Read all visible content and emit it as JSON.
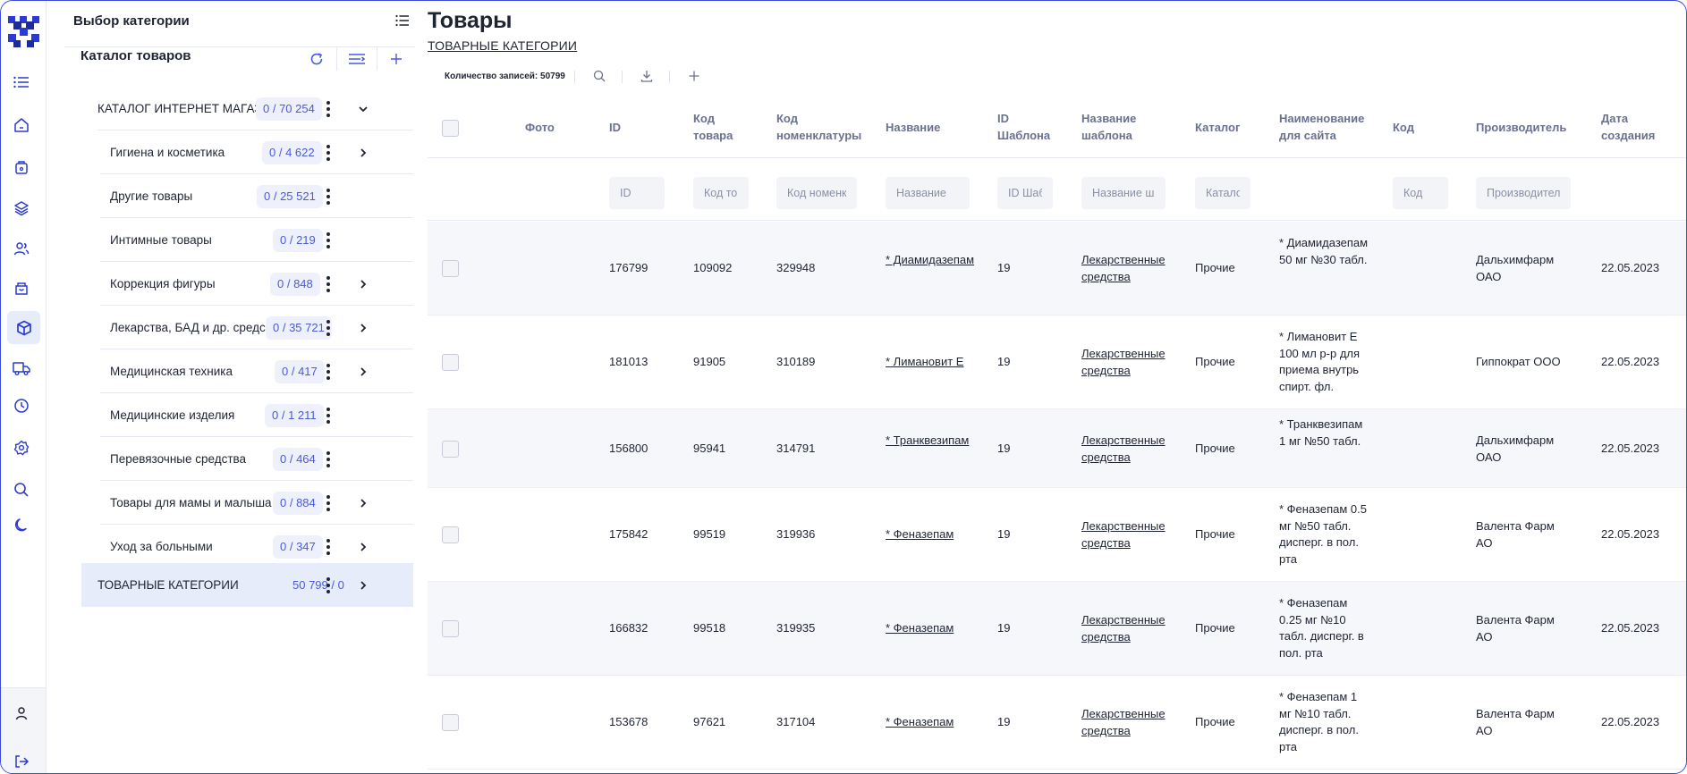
{
  "rail": {
    "items": [
      "list-icon",
      "home-icon",
      "bag-icon",
      "layers-icon",
      "users-icon",
      "box-icon",
      "cube-icon",
      "truck-icon",
      "clock-icon",
      "gear-icon",
      "search-icon",
      "moon-icon"
    ],
    "active": "cube-icon",
    "bottom": [
      "user-icon",
      "logout-icon"
    ]
  },
  "category_panel": {
    "header": "Выбор категории",
    "catalog_title": "Каталог товаров",
    "tree": [
      {
        "label": "КАТАЛОГ ИНТЕРНЕТ МАГАЗИНА",
        "count": "0 / 70 254",
        "expanded": true,
        "root": true
      },
      {
        "label": "Гигиена и косметика",
        "count": "0 / 4 622",
        "has_children": true
      },
      {
        "label": "Другие товары",
        "count": "0 / 25 521",
        "has_children": false
      },
      {
        "label": "Интимные товары",
        "count": "0 / 219",
        "has_children": false
      },
      {
        "label": "Коррекция фигуры",
        "count": "0 / 848",
        "has_children": true
      },
      {
        "label": "Лекарства, БАД и др. средства",
        "count": "0 / 35 721",
        "has_children": true
      },
      {
        "label": "Медицинская техника",
        "count": "0 / 417",
        "has_children": true
      },
      {
        "label": "Медицинские изделия",
        "count": "0 / 1 211",
        "has_children": false
      },
      {
        "label": "Перевязочные средства",
        "count": "0 / 464",
        "has_children": false
      },
      {
        "label": "Товары для мамы и малыша",
        "count": "0 / 884",
        "has_children": true
      },
      {
        "label": "Уход за больными",
        "count": "0 / 347",
        "has_children": true
      },
      {
        "label": "ТОВАРНЫЕ КАТЕГОРИИ",
        "count": "50 799 / 0",
        "has_children": true,
        "root": true,
        "selected": true
      }
    ]
  },
  "main": {
    "title": "Товары",
    "breadcrumb": "ТОВАРНЫЕ КАТЕГОРИИ",
    "records_label": "Количество записей: 50799",
    "columns": [
      {
        "key": "photo",
        "label": "Фото"
      },
      {
        "key": "id",
        "label": "ID",
        "placeholder": "ID"
      },
      {
        "key": "code",
        "label": "Код товара",
        "placeholder": "Код товара"
      },
      {
        "key": "nomen",
        "label": "Код номенклатуры",
        "placeholder": "Код номенклатуры"
      },
      {
        "key": "name",
        "label": "Название",
        "placeholder": "Название"
      },
      {
        "key": "tpl_id",
        "label": "ID Шаблона",
        "placeholder": "ID Шаблона"
      },
      {
        "key": "tpl_name",
        "label": "Название шаблона",
        "placeholder": "Название шаблона"
      },
      {
        "key": "catalog",
        "label": "Каталог",
        "placeholder": "Каталог"
      },
      {
        "key": "site_name",
        "label": "Наименование для сайта"
      },
      {
        "key": "kod",
        "label": "Код",
        "placeholder": "Код"
      },
      {
        "key": "maker",
        "label": "Производитель",
        "placeholder": "Производитель"
      },
      {
        "key": "created",
        "label": "Дата создания"
      }
    ],
    "rows": [
      {
        "id": "176799",
        "code": "109092",
        "nomen": "329948",
        "name": "* Диамидазепам",
        "tpl_id": "19",
        "tpl_name": "Лекарственные средства",
        "catalog": "Прочие",
        "site_name": "* Диамидазепам 50 мг №30 табл.",
        "kod": "",
        "maker": "Дальхимфарм ОАО",
        "created": "22.05.2023"
      },
      {
        "id": "181013",
        "code": "91905",
        "nomen": "310189",
        "name": "* Лимановит Е",
        "tpl_id": "19",
        "tpl_name": "Лекарственные средства",
        "catalog": "Прочие",
        "site_name": "* Лимановит Е 100 мл р-р для приема внутрь спирт. фл.",
        "kod": "",
        "maker": "Гиппократ ООО",
        "created": "22.05.2023"
      },
      {
        "id": "156800",
        "code": "95941",
        "nomen": "314791",
        "name": "* Транквезипам",
        "tpl_id": "19",
        "tpl_name": "Лекарственные средства",
        "catalog": "Прочие",
        "site_name": "* Транквезипам 1 мг №50 табл.",
        "kod": "",
        "maker": "Дальхимфарм ОАО",
        "created": "22.05.2023"
      },
      {
        "id": "175842",
        "code": "99519",
        "nomen": "319936",
        "name": "* Феназепам",
        "tpl_id": "19",
        "tpl_name": "Лекарственные средства",
        "catalog": "Прочие",
        "site_name": "* Феназепам 0.5 мг №50 табл. дисперг. в пол. рта",
        "kod": "",
        "maker": "Валента Фарм АО",
        "created": "22.05.2023"
      },
      {
        "id": "166832",
        "code": "99518",
        "nomen": "319935",
        "name": "* Феназепам",
        "tpl_id": "19",
        "tpl_name": "Лекарственные средства",
        "catalog": "Прочие",
        "site_name": "* Феназепам 0.25 мг №10 табл. дисперг. в пол. рта",
        "kod": "",
        "maker": "Валента Фарм АО",
        "created": "22.05.2023"
      },
      {
        "id": "153678",
        "code": "97621",
        "nomen": "317104",
        "name": "* Феназепам",
        "tpl_id": "19",
        "tpl_name": "Лекарственные средства",
        "catalog": "Прочие",
        "site_name": "* Феназепам 1 мг №10 табл. дисперг. в пол. рта",
        "kod": "",
        "maker": "Валента Фарм АО",
        "created": "22.05.2023"
      }
    ]
  },
  "colors": {
    "accent": "#4a5ad8",
    "selected_bg": "#e7ecfb",
    "logo": "#2b3bd1"
  }
}
